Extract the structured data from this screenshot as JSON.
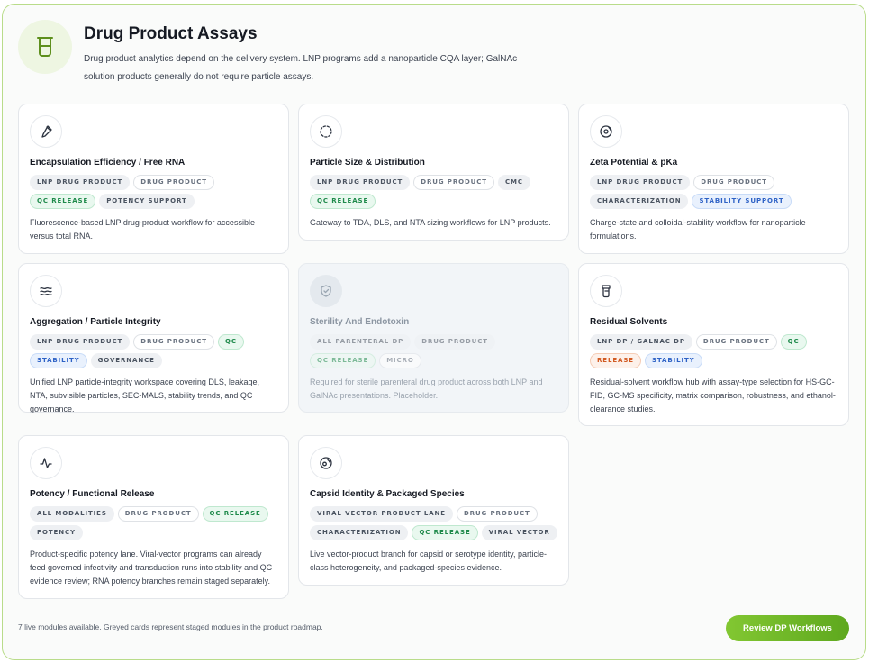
{
  "header": {
    "title": "Drug Product Assays",
    "subtitle": "Drug product analytics depend on the delivery system. LNP programs add a nanoparticle CQA layer; GalNAc solution products generally do not require particle assays.",
    "icon": "beaker-icon"
  },
  "cards": [
    {
      "icon": "pipette-icon",
      "title": "Encapsulation Efficiency / Free RNA",
      "tags": [
        {
          "label": "LNP Drug Product",
          "style": "gray"
        },
        {
          "label": "Drug Product",
          "style": "white"
        },
        {
          "label": "QC Release",
          "style": "green"
        },
        {
          "label": "Potency Support",
          "style": "gray"
        }
      ],
      "description": "Fluorescence-based LNP drug-product workflow for accessible versus total RNA.",
      "staged": false
    },
    {
      "icon": "dashed-circle-icon",
      "title": "Particle Size & Distribution",
      "tags": [
        {
          "label": "LNP Drug Product",
          "style": "gray"
        },
        {
          "label": "Drug Product",
          "style": "white"
        },
        {
          "label": "CMC",
          "style": "gray"
        },
        {
          "label": "QC Release",
          "style": "green"
        }
      ],
      "description": "Gateway to TDA, DLS, and NTA sizing workflows for LNP products.",
      "staged": false
    },
    {
      "icon": "orbit-icon",
      "title": "Zeta Potential & pKa",
      "tags": [
        {
          "label": "LNP Drug Product",
          "style": "gray"
        },
        {
          "label": "Drug Product",
          "style": "white"
        },
        {
          "label": "Characterization",
          "style": "gray"
        },
        {
          "label": "Stability Support",
          "style": "blue"
        }
      ],
      "description": "Charge-state and colloidal-stability workflow for nanoparticle formulations.",
      "staged": false
    },
    {
      "icon": "waves-icon",
      "title": "Aggregation / Particle Integrity",
      "tags": [
        {
          "label": "LNP Drug Product",
          "style": "gray"
        },
        {
          "label": "Drug Product",
          "style": "white"
        },
        {
          "label": "QC",
          "style": "green"
        },
        {
          "label": "Stability",
          "style": "blue"
        },
        {
          "label": "Governance",
          "style": "gray"
        }
      ],
      "description": "Unified LNP particle-integrity workspace covering DLS, leakage, NTA, subvisible particles, SEC-MALS, stability trends, and QC governance.",
      "staged": false
    },
    {
      "icon": "shield-icon",
      "title": "Sterility And Endotoxin",
      "tags": [
        {
          "label": "All Parenteral DP",
          "style": "gray"
        },
        {
          "label": "Drug Product",
          "style": "gray"
        },
        {
          "label": "QC Release",
          "style": "green"
        },
        {
          "label": "Micro",
          "style": "white"
        }
      ],
      "description": "Required for sterile parenteral drug product across both LNP and GalNAc presentations. Placeholder.",
      "staged": true
    },
    {
      "icon": "bottle-icon",
      "title": "Residual Solvents",
      "tags": [
        {
          "label": "LNP DP / GalNAc DP",
          "style": "gray"
        },
        {
          "label": "Drug Product",
          "style": "white"
        },
        {
          "label": "QC",
          "style": "green"
        },
        {
          "label": "Release",
          "style": "orange"
        },
        {
          "label": "Stability",
          "style": "blue"
        }
      ],
      "description": "Residual-solvent workflow hub with assay-type selection for HS-GC-FID, GC-MS specificity, matrix comparison, robustness, and ethanol-clearance studies.",
      "staged": false
    },
    {
      "icon": "activity-icon",
      "title": "Potency / Functional Release",
      "tags": [
        {
          "label": "All Modalities",
          "style": "gray"
        },
        {
          "label": "Drug Product",
          "style": "white"
        },
        {
          "label": "QC Release",
          "style": "green"
        },
        {
          "label": "Potency",
          "style": "gray"
        }
      ],
      "description": "Product-specific potency lane. Viral-vector programs can already feed governed infectivity and transduction runs into stability and QC evidence review; RNA potency branches remain staged separately.",
      "staged": false
    },
    {
      "icon": "capsid-icon",
      "title": "Capsid Identity & Packaged Species",
      "tags": [
        {
          "label": "Viral Vector Product Lane",
          "style": "gray"
        },
        {
          "label": "Drug Product",
          "style": "white"
        },
        {
          "label": "Characterization",
          "style": "gray"
        },
        {
          "label": "QC Release",
          "style": "green"
        },
        {
          "label": "Viral Vector",
          "style": "gray"
        }
      ],
      "description": "Live vector-product branch for capsid or serotype identity, particle-class heterogeneity, and packaged-species evidence.",
      "staged": false
    }
  ],
  "footer": {
    "note": "7 live modules available. Greyed cards represent staged modules in the product roadmap.",
    "cta_label": "Review DP Workflows"
  }
}
